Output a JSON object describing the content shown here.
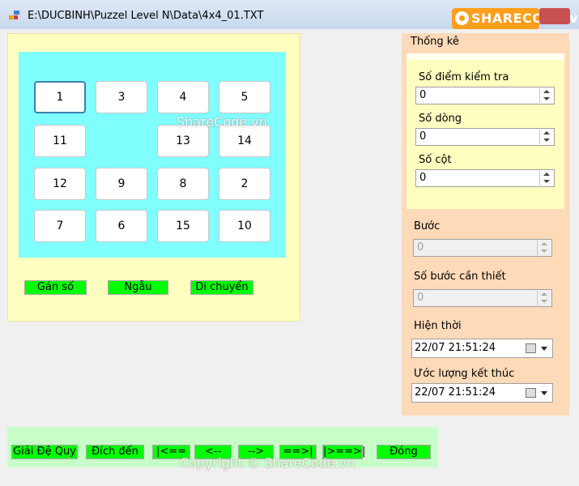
{
  "window": {
    "title": "E:\\DUCBINH\\Puzzel Level N\\Data\\4x4_01.TXT"
  },
  "watermark": {
    "logo": "SHARECODE.vn",
    "center": "ShareCode.vn",
    "bottom": "Copyright © ShareCode.vn"
  },
  "board": {
    "tiles": [
      "1",
      "3",
      "4",
      "5",
      "11",
      "13",
      "14",
      "12",
      "9",
      "8",
      "2",
      "7",
      "6",
      "15",
      "10"
    ]
  },
  "actions": {
    "assign": "Gán số",
    "random": "Ngẫu",
    "move": "Di chuyển"
  },
  "stats": {
    "group_title": "Thống kê",
    "check_points_label": "Số điểm kiểm tra",
    "check_points_value": "0",
    "rows_label": "Số dòng",
    "rows_value": "0",
    "cols_label": "Số cột",
    "cols_value": "0",
    "step_label": "Bước",
    "step_value": "0",
    "needed_label": "Số bước cần thiết",
    "needed_value": "0",
    "current_label": "Hiện thời",
    "current_value": "22/07 21:51:24",
    "estimate_label": "Ước lượng kết thúc",
    "estimate_value": "22/07 21:51:24"
  },
  "bottom": {
    "solve": "Giải Đệ Quy",
    "goal": "Đích đến",
    "first": "|<==",
    "prev": "<--",
    "next": "-->",
    "next_end": "==>|",
    "last": "|>==>|",
    "close": "Đóng"
  }
}
